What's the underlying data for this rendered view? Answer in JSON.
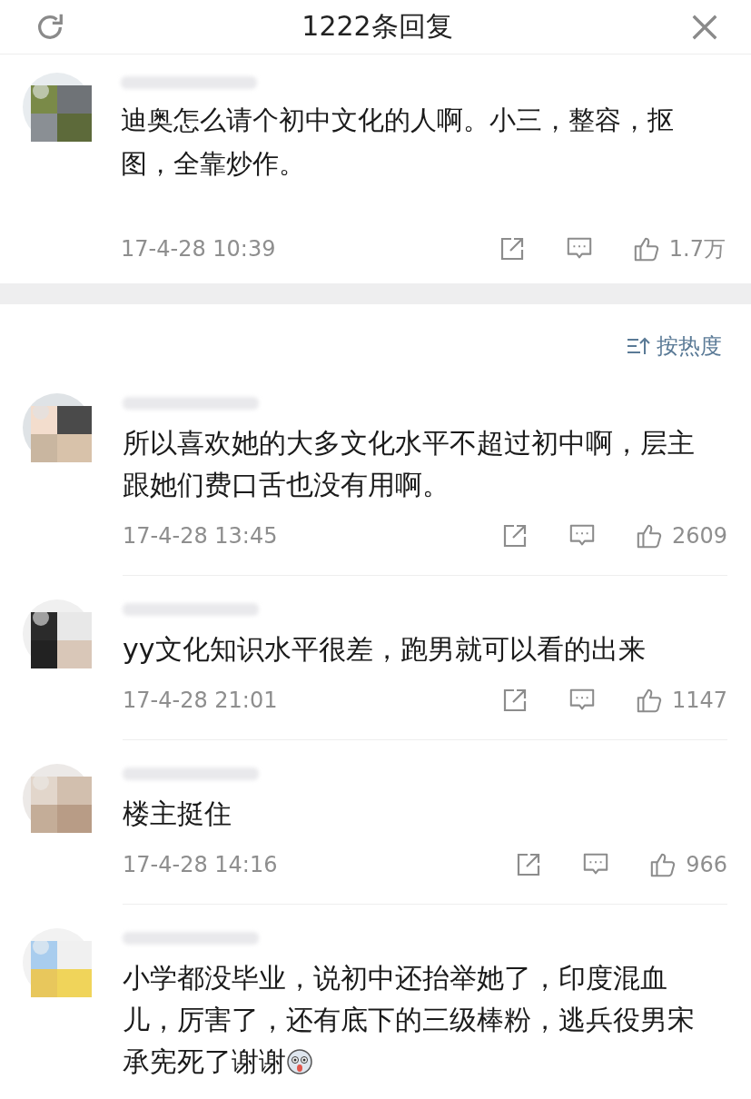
{
  "header": {
    "title": "1222条回复"
  },
  "main_comment": {
    "text": "迪奥怎么请个初中文化的人啊。小三，整容，抠图，全靠炒作。",
    "time": "17-4-28 10:39",
    "likes": "1.7万"
  },
  "sort": {
    "label": "按热度"
  },
  "replies": [
    {
      "text": "所以喜欢她的大多文化水平不超过初中啊，层主跟她们费口舌也没有用啊。",
      "time": "17-4-28 13:45",
      "likes": "2609",
      "emoji": false
    },
    {
      "text": "yy文化知识水平很差，跑男就可以看的出来",
      "time": "17-4-28 21:01",
      "likes": "1147",
      "emoji": false
    },
    {
      "text": "楼主挺住",
      "time": "17-4-28 14:16",
      "likes": "966",
      "emoji": false
    },
    {
      "text": "小学都没毕业，说初中还抬举她了，印度混血儿，厉害了，还有底下的三级棒粉，逃兵役男宋承宪死了谢谢",
      "emoji": true
    }
  ]
}
